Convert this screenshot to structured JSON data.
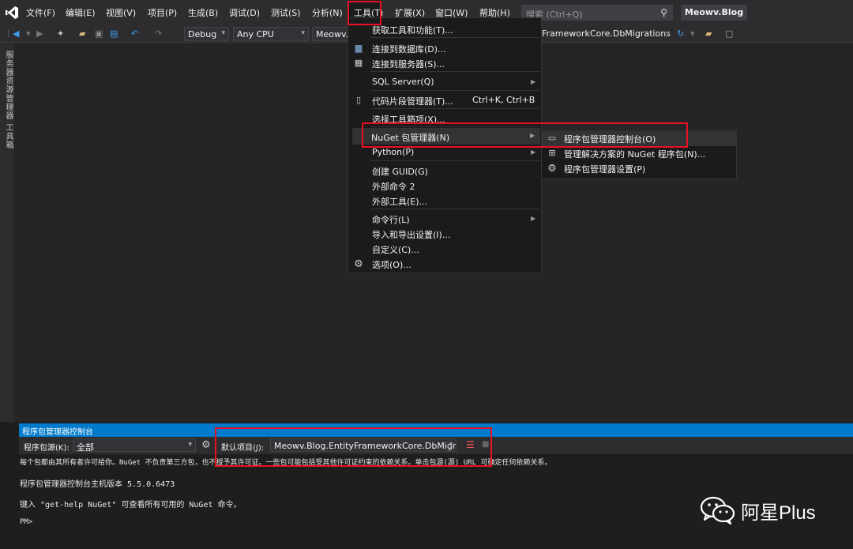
{
  "menubar": {
    "items": [
      "文件(F)",
      "编辑(E)",
      "视图(V)",
      "项目(P)",
      "生成(B)",
      "调试(D)",
      "测试(S)",
      "分析(N)",
      "工具(T)",
      "扩展(X)",
      "窗口(W)",
      "帮助(H)"
    ],
    "search_placeholder": "搜索 (Ctrl+Q)",
    "solution_name": "Meowv.Blog"
  },
  "toolbar": {
    "config": "Debug",
    "platform": "Any CPU",
    "project": "Meowv.B",
    "startup_tail": "FrameworkCore.DbMigrations"
  },
  "left_tabs": {
    "server_explorer": "服务器资源管理器",
    "toolbox": "工具箱"
  },
  "tools_menu": {
    "get_tools": "获取工具和功能(T)...",
    "connect_db": "连接到数据库(D)...",
    "connect_server": "连接到服务器(S)...",
    "sql_server": "SQL Server(Q)",
    "snippets": "代码片段管理器(T)...",
    "snippets_shortcut": "Ctrl+K, Ctrl+B",
    "choose_toolbox": "选择工具箱项(X)...",
    "nuget": "NuGet 包管理器(N)",
    "python": "Python(P)",
    "create_guid": "创建 GUID(G)",
    "external_cmd": "外部命令 2",
    "external_tools": "外部工具(E)...",
    "command_line": "命令行(L)",
    "import_export": "导入和导出设置(I)...",
    "customize": "自定义(C)...",
    "options": "选项(O)..."
  },
  "nuget_submenu": {
    "console": "程序包管理器控制台(O)",
    "manage_solution": "管理解决方案的 NuGet 程序包(N)...",
    "settings": "程序包管理器设置(P)"
  },
  "pm_console": {
    "title": "程序包管理器控制台",
    "source_label": "程序包源(K):",
    "source_value": "全部",
    "default_project_label": "默认项目(J):",
    "default_project_value": "Meowv.Blog.EntityFrameworkCore.DbMigra",
    "line1": "每个包都由其所有者许可给你。NuGet 不负责第三方包，也不授予其许可证。一些包可能包括受其他许可证约束的依赖关系。单击包源(源) URL 可确定任何依赖关系。",
    "line2": "程序包管理器控制台主机版本 5.5.0.6473",
    "line3": "键入 \"get-help NuGet\" 可查看所有可用的 NuGet 命令。",
    "prompt": "PM>"
  },
  "watermark": {
    "text": "阿星Plus"
  }
}
